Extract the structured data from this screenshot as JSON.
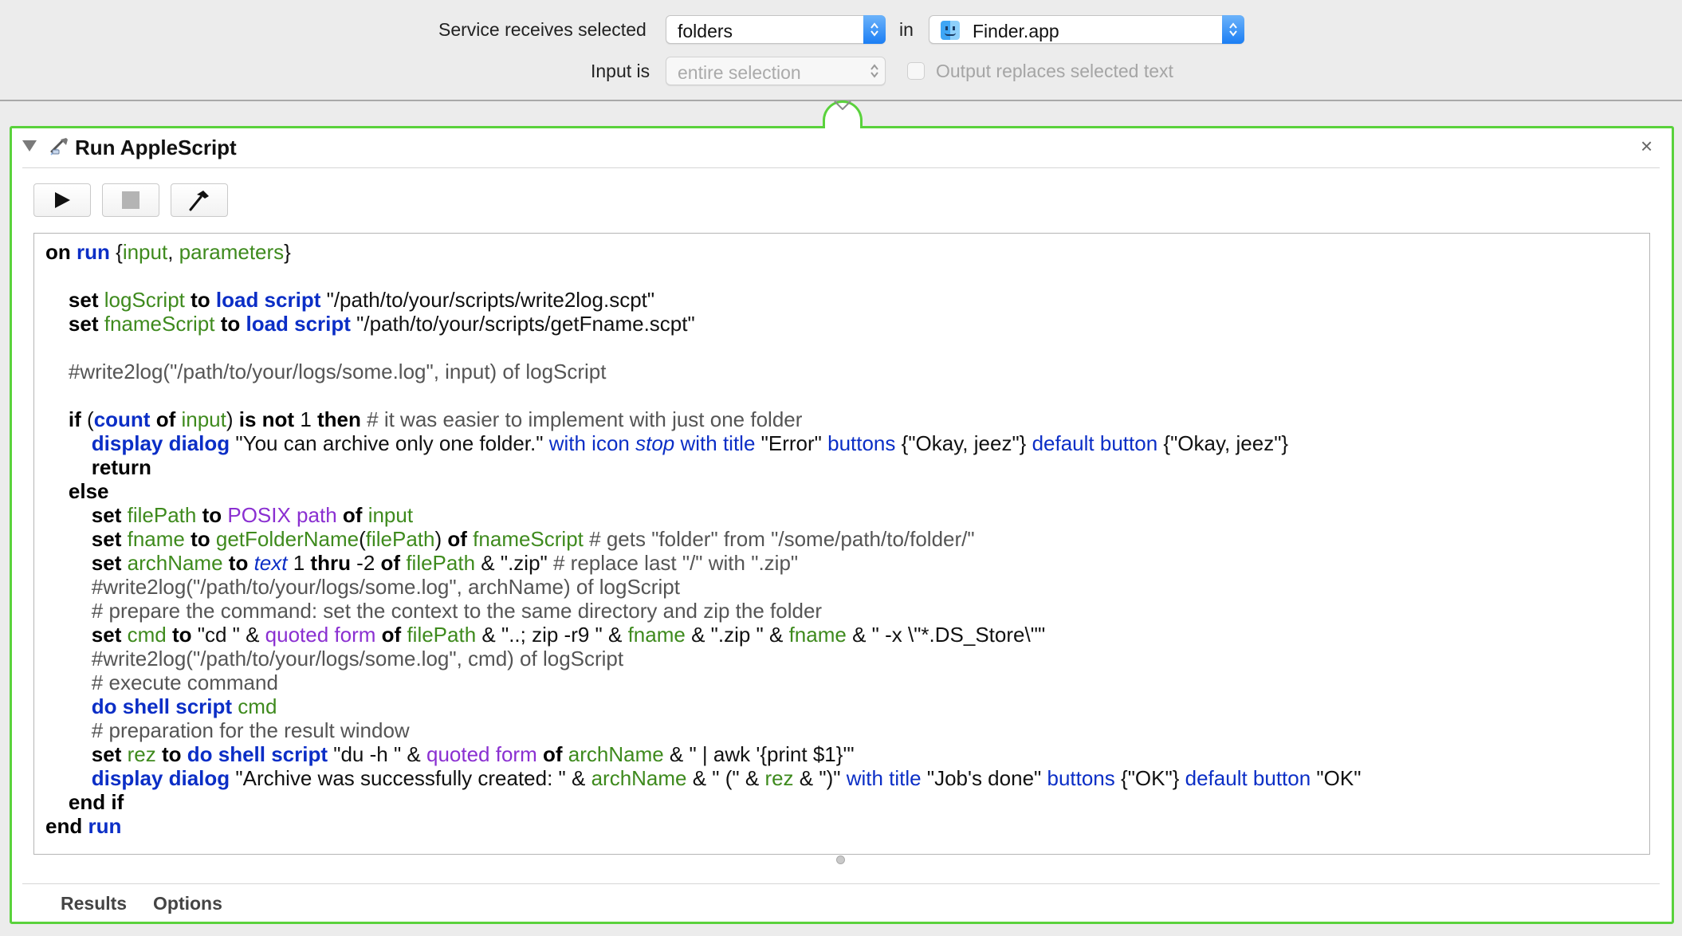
{
  "service": {
    "receives_label": "Service receives selected",
    "receives_value": "folders",
    "in_label": "in",
    "app_value": "Finder.app",
    "input_label": "Input is",
    "input_value": "entire selection",
    "output_replaces_label": "Output replaces selected text",
    "output_replaces_checked": false
  },
  "action": {
    "title": "Run AppleScript",
    "close_glyph": "×",
    "toolbar": [
      "run-button",
      "stop-button",
      "compile-button"
    ],
    "tabs": [
      "Results",
      "Options"
    ]
  },
  "colors": {
    "panel_border": "#5ad23c",
    "applescript_keyword": "#0b2ec6",
    "variable": "#3e8a1d",
    "class": "#8a2fd1",
    "comment": "#555555"
  },
  "code_lines": [
    [
      [
        "kw",
        "on"
      ],
      [
        "p",
        " "
      ],
      [
        "ap",
        "run"
      ],
      [
        "p",
        " {"
      ],
      [
        "var",
        "input"
      ],
      [
        "p",
        ", "
      ],
      [
        "var",
        "parameters"
      ],
      [
        "p",
        "}"
      ]
    ],
    [],
    [
      [
        "p",
        "\t"
      ],
      [
        "kw",
        "set"
      ],
      [
        "p",
        " "
      ],
      [
        "var",
        "logScript"
      ],
      [
        "p",
        " "
      ],
      [
        "kw",
        "to"
      ],
      [
        "p",
        " "
      ],
      [
        "ap",
        "load script"
      ],
      [
        "p",
        " \"/path/to/your/scripts/write2log.scpt\""
      ]
    ],
    [
      [
        "p",
        "\t"
      ],
      [
        "kw",
        "set"
      ],
      [
        "p",
        " "
      ],
      [
        "var",
        "fnameScript"
      ],
      [
        "p",
        " "
      ],
      [
        "kw",
        "to"
      ],
      [
        "p",
        " "
      ],
      [
        "ap",
        "load script"
      ],
      [
        "p",
        " \"/path/to/your/scripts/getFname.scpt\""
      ]
    ],
    [],
    [
      [
        "p",
        "\t"
      ],
      [
        "cmt",
        "#write2log(\"/path/to/your/logs/some.log\", input) of logScript"
      ]
    ],
    [],
    [
      [
        "p",
        "\t"
      ],
      [
        "kw",
        "if"
      ],
      [
        "p",
        " ("
      ],
      [
        "ap",
        "count"
      ],
      [
        "p",
        " "
      ],
      [
        "kw",
        "of"
      ],
      [
        "p",
        " "
      ],
      [
        "var",
        "input"
      ],
      [
        "p",
        ") "
      ],
      [
        "kw",
        "is not"
      ],
      [
        "p",
        " 1 "
      ],
      [
        "kw",
        "then"
      ],
      [
        "p",
        " "
      ],
      [
        "cmt",
        "# it was easier to implement with just one folder"
      ]
    ],
    [
      [
        "p",
        "\t\t"
      ],
      [
        "ap",
        "display dialog"
      ],
      [
        "p",
        " \"You can archive only one folder.\" "
      ],
      [
        "cmd",
        "with icon"
      ],
      [
        "p",
        " "
      ],
      [
        "it",
        "stop"
      ],
      [
        "p",
        " "
      ],
      [
        "cmd",
        "with title"
      ],
      [
        "p",
        " \"Error\" "
      ],
      [
        "cmd",
        "buttons"
      ],
      [
        "p",
        " {\"Okay, jeez\"} "
      ],
      [
        "cmd",
        "default button"
      ],
      [
        "p",
        " {\"Okay, jeez\"}"
      ]
    ],
    [
      [
        "p",
        "\t\t"
      ],
      [
        "kw",
        "return"
      ]
    ],
    [
      [
        "p",
        "\t"
      ],
      [
        "kw",
        "else"
      ]
    ],
    [
      [
        "p",
        "\t\t"
      ],
      [
        "kw",
        "set"
      ],
      [
        "p",
        " "
      ],
      [
        "var",
        "filePath"
      ],
      [
        "p",
        " "
      ],
      [
        "kw",
        "to"
      ],
      [
        "p",
        " "
      ],
      [
        "cls",
        "POSIX path"
      ],
      [
        "p",
        " "
      ],
      [
        "kw",
        "of"
      ],
      [
        "p",
        " "
      ],
      [
        "var",
        "input"
      ]
    ],
    [
      [
        "p",
        "\t\t"
      ],
      [
        "kw",
        "set"
      ],
      [
        "p",
        " "
      ],
      [
        "var",
        "fname"
      ],
      [
        "p",
        " "
      ],
      [
        "kw",
        "to"
      ],
      [
        "p",
        " "
      ],
      [
        "var",
        "getFolderName"
      ],
      [
        "p",
        "("
      ],
      [
        "var",
        "filePath"
      ],
      [
        "p",
        ") "
      ],
      [
        "kw",
        "of"
      ],
      [
        "p",
        " "
      ],
      [
        "var",
        "fnameScript"
      ],
      [
        "p",
        " "
      ],
      [
        "cmt",
        "# gets \"folder\" from \"/some/path/to/folder/\""
      ]
    ],
    [
      [
        "p",
        "\t\t"
      ],
      [
        "kw",
        "set"
      ],
      [
        "p",
        " "
      ],
      [
        "var",
        "archName"
      ],
      [
        "p",
        " "
      ],
      [
        "kw",
        "to"
      ],
      [
        "p",
        " "
      ],
      [
        "it",
        "text"
      ],
      [
        "p",
        " 1 "
      ],
      [
        "kw",
        "thru"
      ],
      [
        "p",
        " -2 "
      ],
      [
        "kw",
        "of"
      ],
      [
        "p",
        " "
      ],
      [
        "var",
        "filePath"
      ],
      [
        "p",
        " & \".zip\" "
      ],
      [
        "cmt",
        "# replace last \"/\" with \".zip\""
      ]
    ],
    [
      [
        "p",
        "\t\t"
      ],
      [
        "cmt",
        "#write2log(\"/path/to/your/logs/some.log\", archName) of logScript"
      ]
    ],
    [
      [
        "p",
        "\t\t"
      ],
      [
        "cmt",
        "# prepare the command: set the context to the same directory and zip the folder"
      ]
    ],
    [
      [
        "p",
        "\t\t"
      ],
      [
        "kw",
        "set"
      ],
      [
        "p",
        " "
      ],
      [
        "var",
        "cmd"
      ],
      [
        "p",
        " "
      ],
      [
        "kw",
        "to"
      ],
      [
        "p",
        " \"cd \" & "
      ],
      [
        "cls",
        "quoted form"
      ],
      [
        "p",
        " "
      ],
      [
        "kw",
        "of"
      ],
      [
        "p",
        " "
      ],
      [
        "var",
        "filePath"
      ],
      [
        "p",
        " & \"..; zip -r9 \" & "
      ],
      [
        "var",
        "fname"
      ],
      [
        "p",
        " & \".zip \" & "
      ],
      [
        "var",
        "fname"
      ],
      [
        "p",
        " & \" -x \\\"*.DS_Store\\\"\""
      ]
    ],
    [
      [
        "p",
        "\t\t"
      ],
      [
        "cmt",
        "#write2log(\"/path/to/your/logs/some.log\", cmd) of logScript"
      ]
    ],
    [
      [
        "p",
        "\t\t"
      ],
      [
        "cmt",
        "# execute command"
      ]
    ],
    [
      [
        "p",
        "\t\t"
      ],
      [
        "ap",
        "do shell script"
      ],
      [
        "p",
        " "
      ],
      [
        "var",
        "cmd"
      ]
    ],
    [
      [
        "p",
        "\t\t"
      ],
      [
        "cmt",
        "# preparation for the result window"
      ]
    ],
    [
      [
        "p",
        "\t\t"
      ],
      [
        "kw",
        "set"
      ],
      [
        "p",
        " "
      ],
      [
        "var",
        "rez"
      ],
      [
        "p",
        " "
      ],
      [
        "kw",
        "to"
      ],
      [
        "p",
        " "
      ],
      [
        "ap",
        "do shell script"
      ],
      [
        "p",
        " \"du -h \" & "
      ],
      [
        "cls",
        "quoted form"
      ],
      [
        "p",
        " "
      ],
      [
        "kw",
        "of"
      ],
      [
        "p",
        " "
      ],
      [
        "var",
        "archName"
      ],
      [
        "p",
        " & \" | awk '{print $1}'\""
      ]
    ],
    [
      [
        "p",
        "\t\t"
      ],
      [
        "ap",
        "display dialog"
      ],
      [
        "p",
        " \"Archive was successfully created: \" & "
      ],
      [
        "var",
        "archName"
      ],
      [
        "p",
        " & \" (\" & "
      ],
      [
        "var",
        "rez"
      ],
      [
        "p",
        " & \")\" "
      ],
      [
        "cmd",
        "with title"
      ],
      [
        "p",
        " \"Job's done\" "
      ],
      [
        "cmd",
        "buttons"
      ],
      [
        "p",
        " {\"OK\"} "
      ],
      [
        "cmd",
        "default button"
      ],
      [
        "p",
        " \"OK\""
      ]
    ],
    [
      [
        "p",
        "\t"
      ],
      [
        "kw",
        "end if"
      ]
    ],
    [
      [
        "kw",
        "end"
      ],
      [
        "p",
        " "
      ],
      [
        "ap",
        "run"
      ]
    ]
  ]
}
